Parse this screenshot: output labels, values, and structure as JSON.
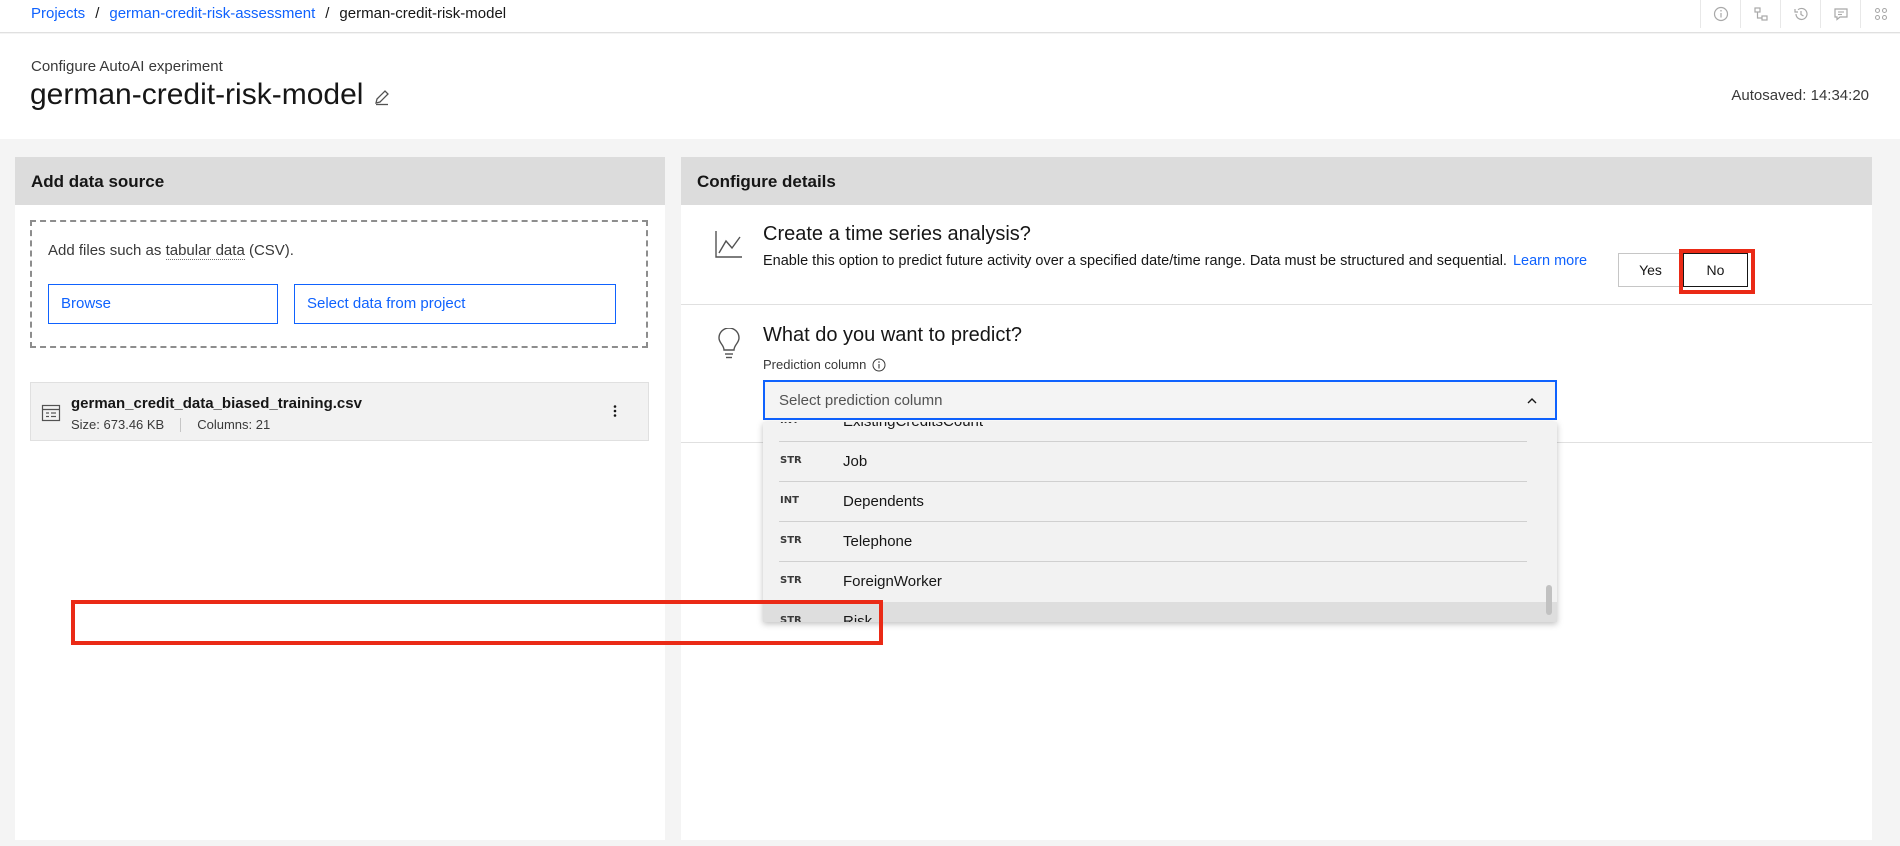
{
  "breadcrumb": {
    "projects": "Projects",
    "project": "german-credit-risk-assessment",
    "current": "german-credit-risk-model",
    "separator": "/"
  },
  "header": {
    "subtitle": "Configure AutoAI experiment",
    "title": "german-credit-risk-model",
    "autosaved": "Autosaved: 14:34:20"
  },
  "top_icons": [
    "info-icon",
    "flow-icon",
    "history-icon",
    "chat-icon",
    "collaborators-icon"
  ],
  "data_source": {
    "heading": "Add data source",
    "dropzone_prefix": "Add files such as ",
    "dropzone_link": "tabular data",
    "dropzone_suffix": " (CSV).",
    "browse_label": "Browse",
    "select_project_label": "Select data from project",
    "file": {
      "name": "german_credit_data_biased_training.csv",
      "size": "Size: 673.46 KB",
      "columns": "Columns: 21"
    }
  },
  "configure": {
    "heading": "Configure details",
    "time_series": {
      "title": "Create a time series analysis?",
      "description": "Enable this option to predict future activity over a specified date/time range. Data must be structured and sequential.",
      "learn_more": "Learn more",
      "yes_label": "Yes",
      "no_label": "No",
      "selected": "No"
    },
    "predict": {
      "title": "What do you want to predict?",
      "label": "Prediction column",
      "placeholder": "Select prediction column",
      "options": [
        {
          "type": "INT",
          "name": "ExistingCreditsCount"
        },
        {
          "type": "STR",
          "name": "Job"
        },
        {
          "type": "INT",
          "name": "Dependents"
        },
        {
          "type": "STR",
          "name": "Telephone"
        },
        {
          "type": "STR",
          "name": "ForeignWorker"
        },
        {
          "type": "STR",
          "name": "Risk"
        }
      ],
      "highlighted_option": "Risk"
    }
  },
  "colors": {
    "link": "#0f62fe",
    "highlight": "#ea2a16",
    "panel_header": "#dcdcdc"
  }
}
